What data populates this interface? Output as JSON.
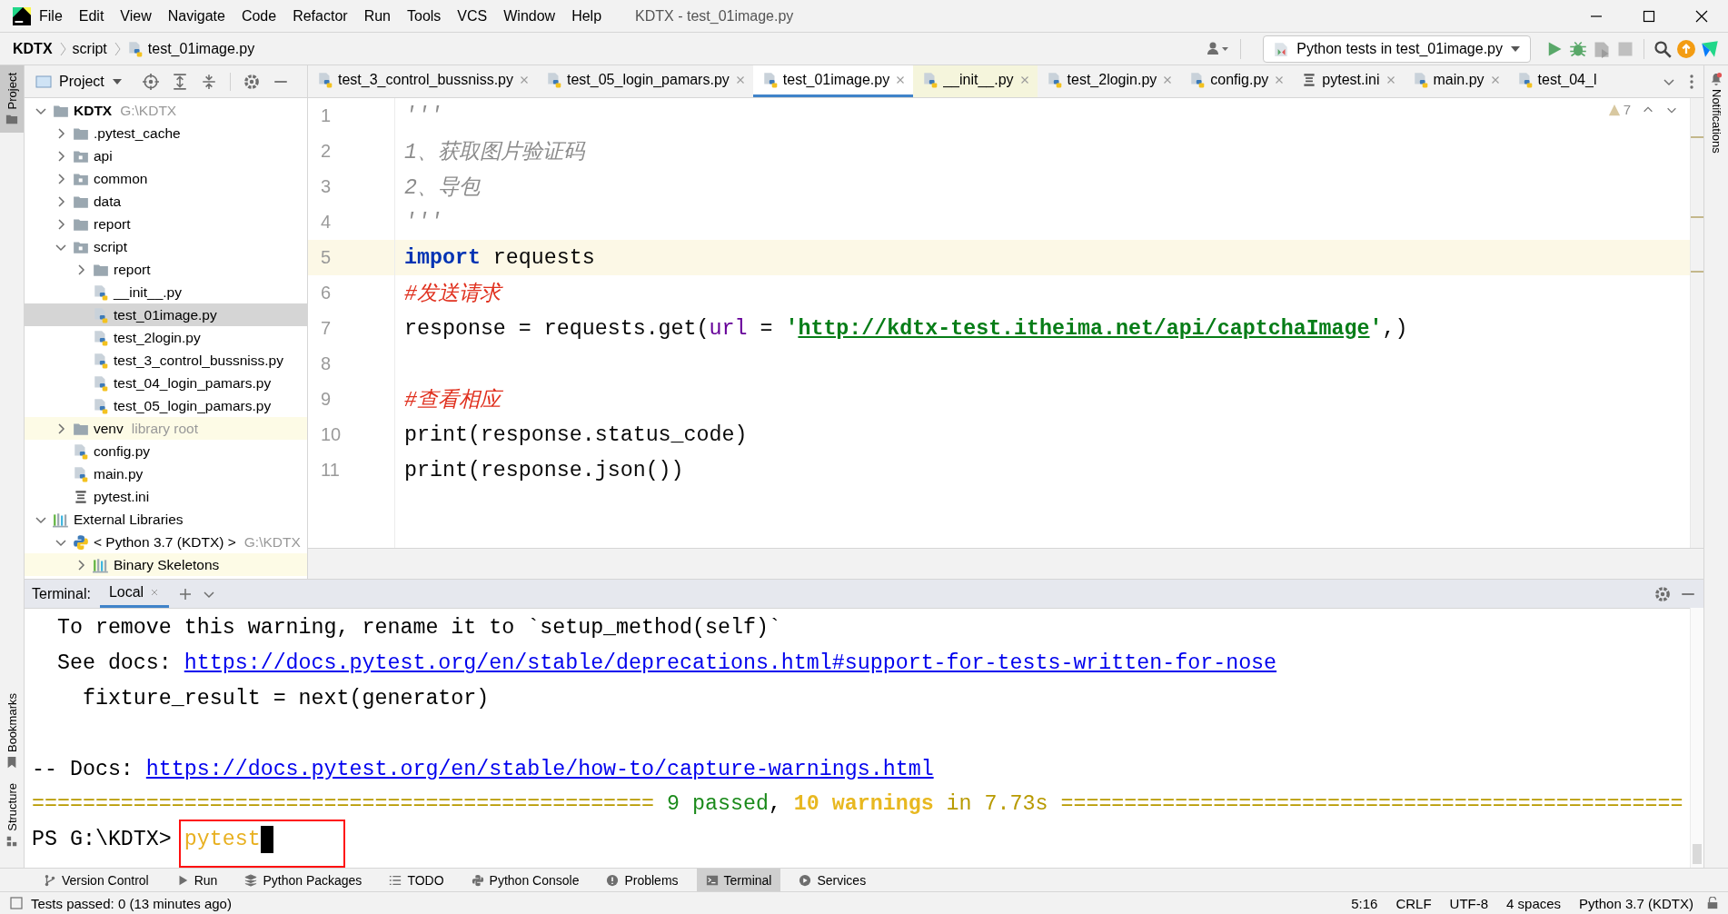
{
  "menubar": {
    "items": [
      "File",
      "Edit",
      "View",
      "Navigate",
      "Code",
      "Refactor",
      "Run",
      "Tools",
      "VCS",
      "Window",
      "Help"
    ],
    "title": "KDTX - test_01image.py"
  },
  "navbar": {
    "breadcrumbs": [
      {
        "label": "KDTX",
        "kind": "project"
      },
      {
        "label": "script",
        "kind": "folder"
      },
      {
        "label": "test_01image.py",
        "kind": "py"
      }
    ],
    "run_config": "Python tests in test_01image.py"
  },
  "left_strip": {
    "top_tabs": [
      {
        "label": "Project",
        "selected": true
      }
    ],
    "bottom_tabs": [
      {
        "label": "Bookmarks",
        "selected": false
      },
      {
        "label": "Structure",
        "selected": false
      }
    ]
  },
  "right_strip": {
    "tabs": [
      {
        "label": "Notifications",
        "selected": false
      }
    ]
  },
  "project": {
    "title": "Project",
    "tree": [
      {
        "label": "KDTX",
        "hint": "G:\\KDTX",
        "kind": "folder",
        "expanded": true,
        "selected": false,
        "library": false,
        "children": [
          {
            "label": ".pytest_cache",
            "kind": "folder",
            "expanded": false,
            "selected": false,
            "library": false
          },
          {
            "label": "api",
            "kind": "package",
            "expanded": false,
            "selected": false,
            "library": false
          },
          {
            "label": "common",
            "kind": "package",
            "expanded": false,
            "selected": false,
            "library": false
          },
          {
            "label": "data",
            "kind": "folder",
            "expanded": false,
            "selected": false,
            "library": false
          },
          {
            "label": "report",
            "kind": "folder",
            "expanded": false,
            "selected": false,
            "library": false
          },
          {
            "label": "script",
            "kind": "package",
            "expanded": true,
            "selected": false,
            "library": false,
            "children": [
              {
                "label": "report",
                "kind": "folder",
                "expanded": false,
                "selected": false,
                "library": false
              },
              {
                "label": "__init__.py",
                "kind": "py",
                "selected": false,
                "library": false
              },
              {
                "label": "test_01image.py",
                "kind": "py",
                "selected": true,
                "library": false
              },
              {
                "label": "test_2login.py",
                "kind": "py",
                "selected": false,
                "library": false
              },
              {
                "label": "test_3_control_bussniss.py",
                "kind": "py",
                "selected": false,
                "library": false
              },
              {
                "label": "test_04_login_pamars.py",
                "kind": "py",
                "selected": false,
                "library": false
              },
              {
                "label": "test_05_login_pamars.py",
                "kind": "py",
                "selected": false,
                "library": false
              }
            ]
          },
          {
            "label": "venv",
            "hint": "library root",
            "kind": "folder",
            "expanded": false,
            "selected": false,
            "library": true
          },
          {
            "label": "config.py",
            "kind": "py",
            "selected": false,
            "library": false
          },
          {
            "label": "main.py",
            "kind": "py",
            "selected": false,
            "library": false
          },
          {
            "label": "pytest.ini",
            "kind": "ini",
            "selected": false,
            "library": false
          }
        ]
      },
      {
        "label": "External Libraries",
        "kind": "libs",
        "expanded": true,
        "selected": false,
        "library": false,
        "children": [
          {
            "label": "< Python 3.7 (KDTX) >",
            "hint": "G:\\KDTX",
            "kind": "python",
            "expanded": true,
            "selected": false,
            "library": false,
            "children": [
              {
                "label": "Binary Skeletons",
                "kind": "libs",
                "expanded": false,
                "selected": false,
                "library": true
              }
            ]
          }
        ]
      }
    ]
  },
  "editor": {
    "tabs": [
      {
        "label": "test_3_control_bussniss.py",
        "kind": "py",
        "selected": false,
        "tinted": false,
        "closable": true
      },
      {
        "label": "test_05_login_pamars.py",
        "kind": "py",
        "selected": false,
        "tinted": false,
        "closable": true
      },
      {
        "label": "test_01image.py",
        "kind": "py",
        "selected": true,
        "tinted": false,
        "closable": true
      },
      {
        "label": "__init__.py",
        "kind": "py",
        "selected": false,
        "tinted": true,
        "closable": true
      },
      {
        "label": "test_2login.py",
        "kind": "py",
        "selected": false,
        "tinted": false,
        "closable": true
      },
      {
        "label": "config.py",
        "kind": "py",
        "selected": false,
        "tinted": false,
        "closable": true
      },
      {
        "label": "pytest.ini",
        "kind": "ini",
        "selected": false,
        "tinted": false,
        "closable": true
      },
      {
        "label": "main.py",
        "kind": "py",
        "selected": false,
        "tinted": false,
        "closable": true
      },
      {
        "label": "test_04_l",
        "kind": "py",
        "selected": false,
        "tinted": false,
        "closable": false
      }
    ],
    "warnings": "7",
    "lines": [
      {
        "number": "1",
        "current": false,
        "tokens": [
          {
            "text": "'''",
            "kind": "doc"
          }
        ]
      },
      {
        "number": "2",
        "current": false,
        "tokens": [
          {
            "text": "1、获取图片验证码",
            "kind": "doc"
          }
        ]
      },
      {
        "number": "3",
        "current": false,
        "tokens": [
          {
            "text": "2、导包",
            "kind": "doc"
          }
        ]
      },
      {
        "number": "4",
        "current": false,
        "tokens": [
          {
            "text": "'''",
            "kind": "doc"
          }
        ]
      },
      {
        "number": "5",
        "current": true,
        "tokens": [
          {
            "text": "import",
            "kind": "keyword"
          },
          {
            "text": " requests",
            "kind": "plain"
          }
        ]
      },
      {
        "number": "6",
        "current": false,
        "tokens": [
          {
            "text": "#发送请求",
            "kind": "comment"
          }
        ]
      },
      {
        "number": "7",
        "current": false,
        "tokens": [
          {
            "text": "response = requests.get(",
            "kind": "plain"
          },
          {
            "text": "url",
            "kind": "param"
          },
          {
            "text": " = ",
            "kind": "plain"
          },
          {
            "text": "'",
            "kind": "string"
          },
          {
            "text": "http://kdtx-test.itheima.net/api/captchaImage",
            "kind": "url"
          },
          {
            "text": "'",
            "kind": "string"
          },
          {
            "text": ",)",
            "kind": "plain"
          }
        ]
      },
      {
        "number": "8",
        "current": false
      },
      {
        "number": "9",
        "current": false,
        "tokens": [
          {
            "text": "#查看相应",
            "kind": "comment"
          }
        ]
      },
      {
        "number": "10",
        "current": false,
        "tokens": [
          {
            "text": "print(response.status_code)",
            "kind": "plain"
          }
        ]
      },
      {
        "number": "11",
        "current": false,
        "tokens": [
          {
            "text": "print(response.json())",
            "kind": "plain"
          }
        ]
      }
    ]
  },
  "terminal": {
    "title": "Terminal:",
    "tabs": [
      {
        "label": "Local",
        "selected": true
      }
    ],
    "lines": [
      {
        "kind": "text",
        "highlighted": false,
        "segments": [
          {
            "text": "  To remove this warning, rename it to `setup_method(self)`",
            "kind": "plain"
          }
        ]
      },
      {
        "kind": "text",
        "highlighted": false,
        "segments": [
          {
            "text": "  See docs: ",
            "kind": "plain"
          },
          {
            "text": "https://docs.pytest.org/en/stable/deprecations.html#support-for-tests-written-for-nose",
            "kind": "link"
          }
        ]
      },
      {
        "kind": "text",
        "highlighted": false,
        "segments": [
          {
            "text": "    fixture_result = next(generator)",
            "kind": "plain"
          }
        ]
      },
      {
        "kind": "blank",
        "highlighted": false
      },
      {
        "kind": "text",
        "highlighted": false,
        "segments": [
          {
            "text": "-- Docs: ",
            "kind": "plain"
          },
          {
            "text": "https://docs.pytest.org/en/stable/how-to/capture-warnings.html",
            "kind": "link"
          }
        ]
      },
      {
        "kind": "text",
        "highlighted": false,
        "segments": [
          {
            "text": "================================================= ",
            "kind": "rule"
          },
          {
            "text": "9 passed",
            "kind": "passed"
          },
          {
            "text": ", ",
            "kind": "plain"
          },
          {
            "text": "10 warnings",
            "kind": "warn"
          },
          {
            "text": " in 7.73s =================================================",
            "kind": "rule"
          }
        ]
      },
      {
        "kind": "prompt",
        "highlighted": true,
        "segments": [
          {
            "text": "PS G:\\KDTX> ",
            "kind": "plain"
          },
          {
            "text": "pytest",
            "kind": "command"
          }
        ]
      }
    ]
  },
  "tool_windows": [
    {
      "label": "Version Control",
      "kind": "vcs",
      "selected": false
    },
    {
      "label": "Run",
      "kind": "run",
      "selected": false
    },
    {
      "label": "Python Packages",
      "kind": "packages",
      "selected": false
    },
    {
      "label": "TODO",
      "kind": "todo",
      "selected": false
    },
    {
      "label": "Python Console",
      "kind": "console",
      "selected": false
    },
    {
      "label": "Problems",
      "kind": "problems",
      "selected": false
    },
    {
      "label": "Terminal",
      "kind": "terminal",
      "selected": true
    },
    {
      "label": "Services",
      "kind": "services",
      "selected": false
    }
  ],
  "status_bar": {
    "message": "Tests passed: 0 (13 minutes ago)",
    "items": [
      "5:16",
      "CRLF",
      "UTF-8",
      "4 spaces",
      "Python 3.7 (KDTX)"
    ]
  }
}
